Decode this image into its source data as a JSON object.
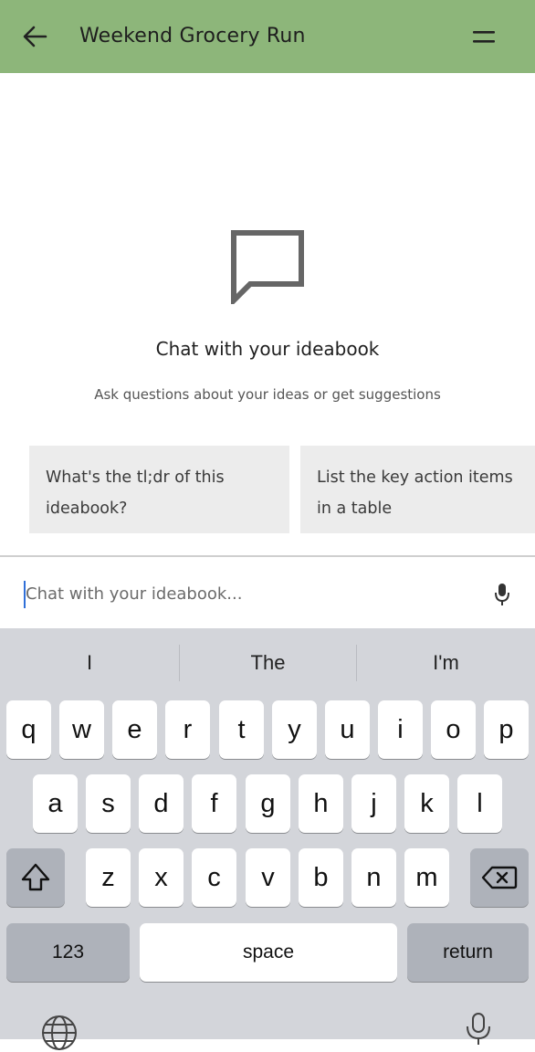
{
  "header": {
    "title": "Weekend Grocery Run",
    "back_icon": "arrow-left-icon",
    "menu_icon": "equals-menu-icon",
    "background": "#8db67a"
  },
  "empty_state": {
    "icon": "chat-bubble-icon",
    "title": "Chat with your ideabook",
    "subtitle": "Ask questions about your ideas or get suggestions"
  },
  "suggestions": [
    {
      "line1": "What's the tl;dr of this",
      "line2": "ideabook?"
    },
    {
      "line1": "List the key action items",
      "line2": "in a table"
    }
  ],
  "chat_input": {
    "placeholder": "Chat with your ideabook...",
    "value": "",
    "mic_icon": "microphone-icon"
  },
  "keyboard": {
    "predictions": [
      "I",
      "The",
      "I'm"
    ],
    "row1": [
      "q",
      "w",
      "e",
      "r",
      "t",
      "y",
      "u",
      "i",
      "o",
      "p"
    ],
    "row2": [
      "a",
      "s",
      "d",
      "f",
      "g",
      "h",
      "j",
      "k",
      "l"
    ],
    "row3": [
      "z",
      "x",
      "c",
      "v",
      "b",
      "n",
      "m"
    ],
    "shift_icon": "shift-icon",
    "backspace_icon": "backspace-icon",
    "numbers_label": "123",
    "space_label": "space",
    "return_label": "return",
    "globe_icon": "globe-icon",
    "dictation_icon": "dictation-icon"
  }
}
